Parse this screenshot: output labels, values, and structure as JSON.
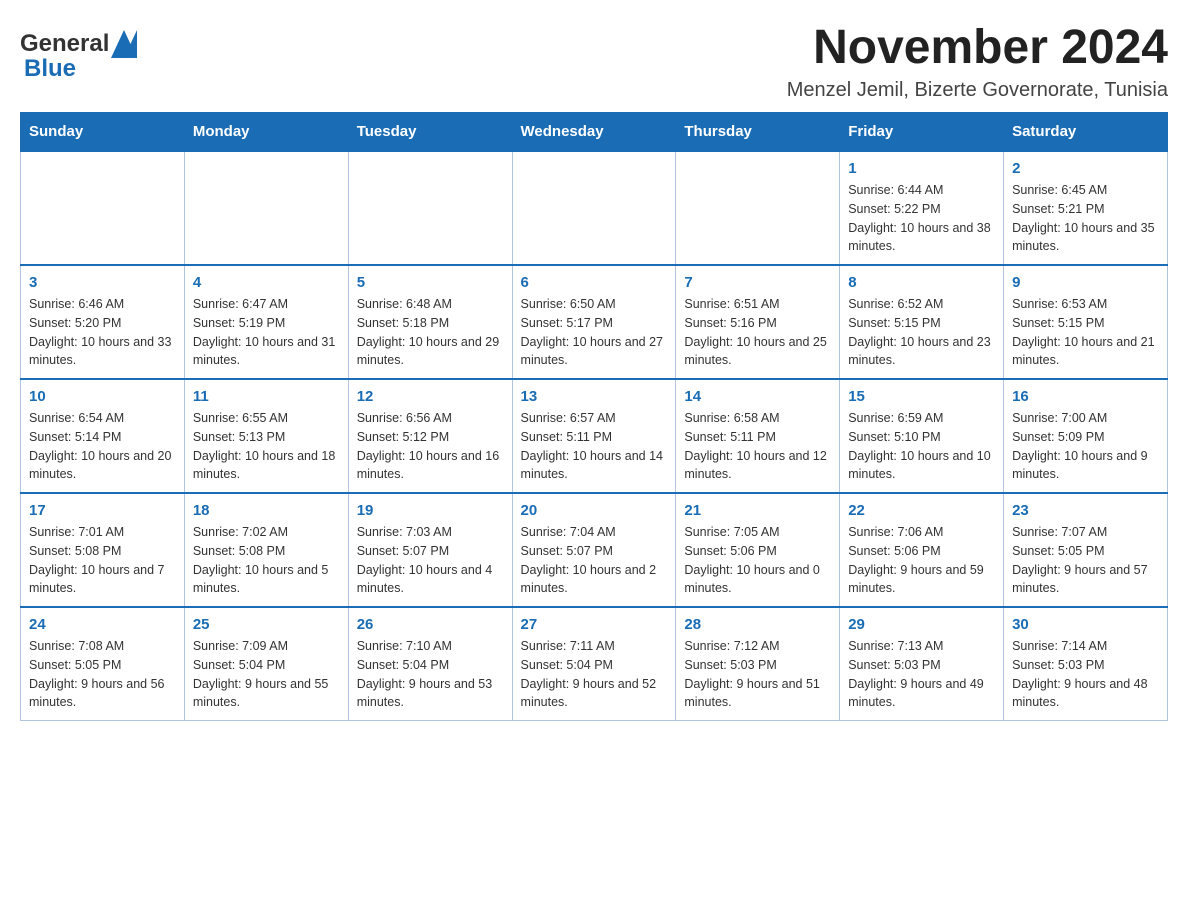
{
  "header": {
    "logo_general": "General",
    "logo_blue": "Blue",
    "title": "November 2024",
    "subtitle": "Menzel Jemil, Bizerte Governorate, Tunisia"
  },
  "calendar": {
    "days_of_week": [
      "Sunday",
      "Monday",
      "Tuesday",
      "Wednesday",
      "Thursday",
      "Friday",
      "Saturday"
    ],
    "weeks": [
      [
        {
          "day": "",
          "info": ""
        },
        {
          "day": "",
          "info": ""
        },
        {
          "day": "",
          "info": ""
        },
        {
          "day": "",
          "info": ""
        },
        {
          "day": "",
          "info": ""
        },
        {
          "day": "1",
          "info": "Sunrise: 6:44 AM\nSunset: 5:22 PM\nDaylight: 10 hours and 38 minutes."
        },
        {
          "day": "2",
          "info": "Sunrise: 6:45 AM\nSunset: 5:21 PM\nDaylight: 10 hours and 35 minutes."
        }
      ],
      [
        {
          "day": "3",
          "info": "Sunrise: 6:46 AM\nSunset: 5:20 PM\nDaylight: 10 hours and 33 minutes."
        },
        {
          "day": "4",
          "info": "Sunrise: 6:47 AM\nSunset: 5:19 PM\nDaylight: 10 hours and 31 minutes."
        },
        {
          "day": "5",
          "info": "Sunrise: 6:48 AM\nSunset: 5:18 PM\nDaylight: 10 hours and 29 minutes."
        },
        {
          "day": "6",
          "info": "Sunrise: 6:50 AM\nSunset: 5:17 PM\nDaylight: 10 hours and 27 minutes."
        },
        {
          "day": "7",
          "info": "Sunrise: 6:51 AM\nSunset: 5:16 PM\nDaylight: 10 hours and 25 minutes."
        },
        {
          "day": "8",
          "info": "Sunrise: 6:52 AM\nSunset: 5:15 PM\nDaylight: 10 hours and 23 minutes."
        },
        {
          "day": "9",
          "info": "Sunrise: 6:53 AM\nSunset: 5:15 PM\nDaylight: 10 hours and 21 minutes."
        }
      ],
      [
        {
          "day": "10",
          "info": "Sunrise: 6:54 AM\nSunset: 5:14 PM\nDaylight: 10 hours and 20 minutes."
        },
        {
          "day": "11",
          "info": "Sunrise: 6:55 AM\nSunset: 5:13 PM\nDaylight: 10 hours and 18 minutes."
        },
        {
          "day": "12",
          "info": "Sunrise: 6:56 AM\nSunset: 5:12 PM\nDaylight: 10 hours and 16 minutes."
        },
        {
          "day": "13",
          "info": "Sunrise: 6:57 AM\nSunset: 5:11 PM\nDaylight: 10 hours and 14 minutes."
        },
        {
          "day": "14",
          "info": "Sunrise: 6:58 AM\nSunset: 5:11 PM\nDaylight: 10 hours and 12 minutes."
        },
        {
          "day": "15",
          "info": "Sunrise: 6:59 AM\nSunset: 5:10 PM\nDaylight: 10 hours and 10 minutes."
        },
        {
          "day": "16",
          "info": "Sunrise: 7:00 AM\nSunset: 5:09 PM\nDaylight: 10 hours and 9 minutes."
        }
      ],
      [
        {
          "day": "17",
          "info": "Sunrise: 7:01 AM\nSunset: 5:08 PM\nDaylight: 10 hours and 7 minutes."
        },
        {
          "day": "18",
          "info": "Sunrise: 7:02 AM\nSunset: 5:08 PM\nDaylight: 10 hours and 5 minutes."
        },
        {
          "day": "19",
          "info": "Sunrise: 7:03 AM\nSunset: 5:07 PM\nDaylight: 10 hours and 4 minutes."
        },
        {
          "day": "20",
          "info": "Sunrise: 7:04 AM\nSunset: 5:07 PM\nDaylight: 10 hours and 2 minutes."
        },
        {
          "day": "21",
          "info": "Sunrise: 7:05 AM\nSunset: 5:06 PM\nDaylight: 10 hours and 0 minutes."
        },
        {
          "day": "22",
          "info": "Sunrise: 7:06 AM\nSunset: 5:06 PM\nDaylight: 9 hours and 59 minutes."
        },
        {
          "day": "23",
          "info": "Sunrise: 7:07 AM\nSunset: 5:05 PM\nDaylight: 9 hours and 57 minutes."
        }
      ],
      [
        {
          "day": "24",
          "info": "Sunrise: 7:08 AM\nSunset: 5:05 PM\nDaylight: 9 hours and 56 minutes."
        },
        {
          "day": "25",
          "info": "Sunrise: 7:09 AM\nSunset: 5:04 PM\nDaylight: 9 hours and 55 minutes."
        },
        {
          "day": "26",
          "info": "Sunrise: 7:10 AM\nSunset: 5:04 PM\nDaylight: 9 hours and 53 minutes."
        },
        {
          "day": "27",
          "info": "Sunrise: 7:11 AM\nSunset: 5:04 PM\nDaylight: 9 hours and 52 minutes."
        },
        {
          "day": "28",
          "info": "Sunrise: 7:12 AM\nSunset: 5:03 PM\nDaylight: 9 hours and 51 minutes."
        },
        {
          "day": "29",
          "info": "Sunrise: 7:13 AM\nSunset: 5:03 PM\nDaylight: 9 hours and 49 minutes."
        },
        {
          "day": "30",
          "info": "Sunrise: 7:14 AM\nSunset: 5:03 PM\nDaylight: 9 hours and 48 minutes."
        }
      ]
    ]
  }
}
